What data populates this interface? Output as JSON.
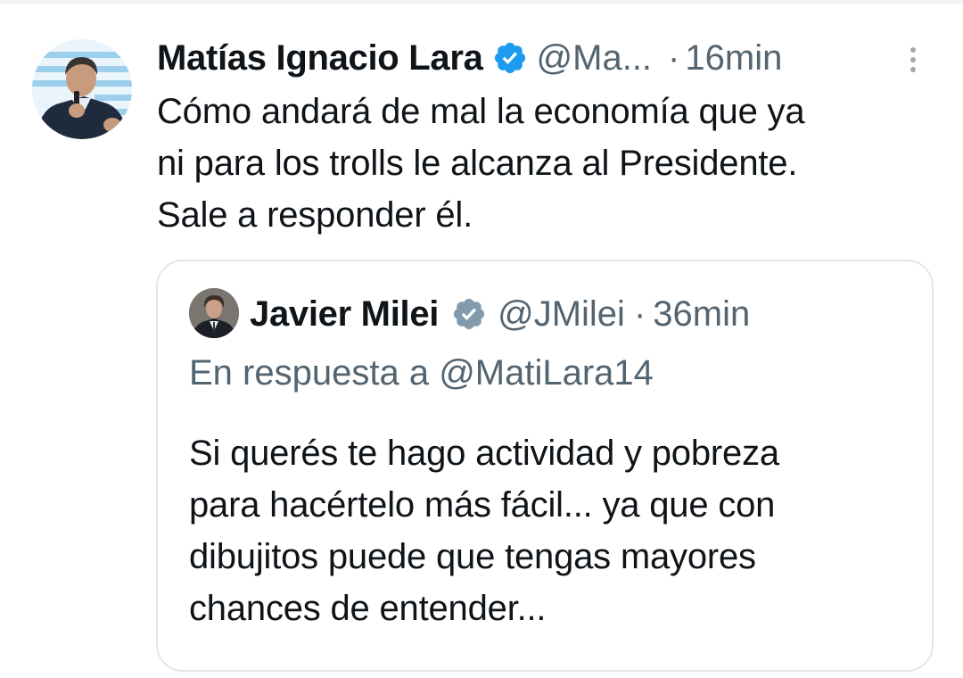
{
  "tweet": {
    "author_name": "Matías Ignacio Lara",
    "author_handle": "@Ma...",
    "separator": "·",
    "time": "16min",
    "text": "Cómo andará de mal la economía que ya\nni para los trolls le alcanza al Presidente.\nSale a responder él.",
    "verified_icon": "verified-badge-blue",
    "more_icon": "more-vertical-icon",
    "colors": {
      "verified": "#1d9bf0",
      "secondary_text": "#536471",
      "primary_text": "#0f1419"
    }
  },
  "quoted_tweet": {
    "author_name": "Javier Milei",
    "author_handle": "@JMilei",
    "separator": "·",
    "time": "36min",
    "reply_prefix": "En respuesta a ",
    "reply_handle": "@MatiLara14",
    "text": "Si querés te hago actividad y pobreza\npara hacértelo más fácil... ya que con\ndibujitos puede que tengas mayores\nchances de entender...",
    "verified_icon": "verified-badge-gray",
    "colors": {
      "verified": "#829aab"
    }
  }
}
